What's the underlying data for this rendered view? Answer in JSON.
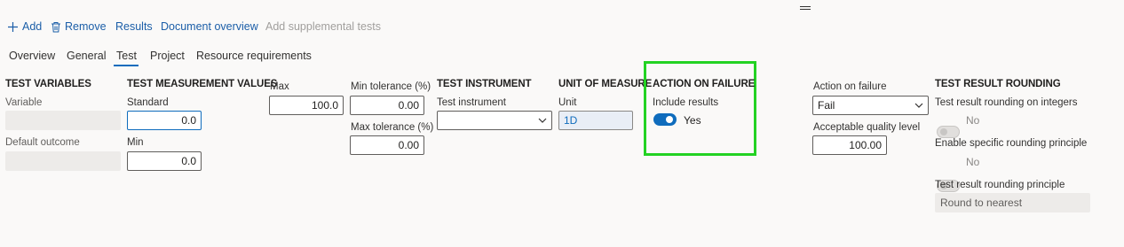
{
  "toolbar": {
    "add_label": "Add",
    "remove_label": "Remove",
    "results_label": "Results",
    "document_overview_label": "Document overview",
    "add_supplemental_label": "Add supplemental tests"
  },
  "tabs": [
    "Overview",
    "General",
    "Test",
    "Project",
    "Resource requirements"
  ],
  "active_tab": "Test",
  "test_variables": {
    "heading": "TEST VARIABLES",
    "variable_label": "Variable",
    "variable_value": "",
    "default_outcome_label": "Default outcome",
    "default_outcome_value": ""
  },
  "measurement": {
    "heading": "TEST MEASUREMENT VALUES",
    "standard_label": "Standard",
    "standard_value": "0.0",
    "min_label": "Min",
    "min_value": "0.0",
    "max_label": "Max",
    "max_value": "100.0",
    "min_tol_label": "Min tolerance (%)",
    "min_tol_value": "0.00",
    "max_tol_label": "Max tolerance (%)",
    "max_tol_value": "0.00"
  },
  "instrument": {
    "heading": "TEST INSTRUMENT",
    "label": "Test instrument",
    "value": ""
  },
  "unit": {
    "heading": "UNIT OF MEASURE",
    "label": "Unit",
    "value": "1D"
  },
  "action_on_failure": {
    "heading": "ACTION ON FAILURE",
    "include_results_label": "Include results",
    "include_results_on": true,
    "include_results_text": "Yes",
    "action_label": "Action on failure",
    "action_value": "Fail",
    "aql_label": "Acceptable quality level",
    "aql_value": "100.00"
  },
  "rounding": {
    "heading": "TEST RESULT ROUNDING",
    "integers_label": "Test result rounding on integers",
    "integers_text": "No",
    "specific_label": "Enable specific rounding principle",
    "specific_text": "No",
    "principle_label": "Test result rounding principle",
    "principle_value": "Round to nearest"
  },
  "colors": {
    "accent": "#0f6cbd",
    "link": "#1b5ea8",
    "highlight": "#23d223"
  }
}
